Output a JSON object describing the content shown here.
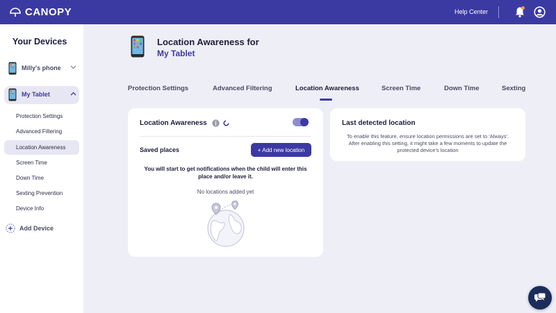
{
  "header": {
    "logo_text": "CANOPY",
    "help_center": "Help Center"
  },
  "sidebar": {
    "title": "Your Devices",
    "devices": [
      {
        "name": "Milly's phone",
        "expanded": false
      },
      {
        "name": "My Tablet",
        "expanded": true
      }
    ],
    "submenu": [
      {
        "label": "Protection Settings"
      },
      {
        "label": "Advanced Filtering"
      },
      {
        "label": "Location Awareness",
        "active": true
      },
      {
        "label": "Screen Time"
      },
      {
        "label": "Down Time"
      },
      {
        "label": "Sexting Prevention"
      },
      {
        "label": "Device Info"
      }
    ],
    "add_device": "Add Device"
  },
  "page": {
    "title": "Location Awareness for",
    "device_name": "My Tablet"
  },
  "tabs": [
    {
      "label": "Protection Settings"
    },
    {
      "label": "Advanced Filtering"
    },
    {
      "label": "Location Awareness",
      "active": true
    },
    {
      "label": "Screen Time"
    },
    {
      "label": "Down Time"
    },
    {
      "label": "Sexting"
    }
  ],
  "location_card": {
    "title": "Location Awareness",
    "toggle_on": true,
    "saved_places": "Saved places",
    "add_button": "+ Add new location",
    "notify_text": "You will start to get notifications when the child will enter this place and/or leave it.",
    "empty_text": "No locations added yet"
  },
  "last_location_card": {
    "title": "Last detected location",
    "text": "To enable this feature, ensure location permissions are set to 'Always'. After enabling this setting, it might take a few moments to update the protected device's location"
  },
  "colors": {
    "brand": "#3b3aa3",
    "background": "#eeeef6",
    "chat_bubble": "#1c2d5a"
  },
  "icons": [
    "canopy-logo-icon",
    "bell-icon",
    "user-icon",
    "phone-icon",
    "chevron-down-icon",
    "chevron-up-icon",
    "plus-circle-icon",
    "info-icon",
    "loader-icon",
    "globe-illustration",
    "chat-icon"
  ]
}
